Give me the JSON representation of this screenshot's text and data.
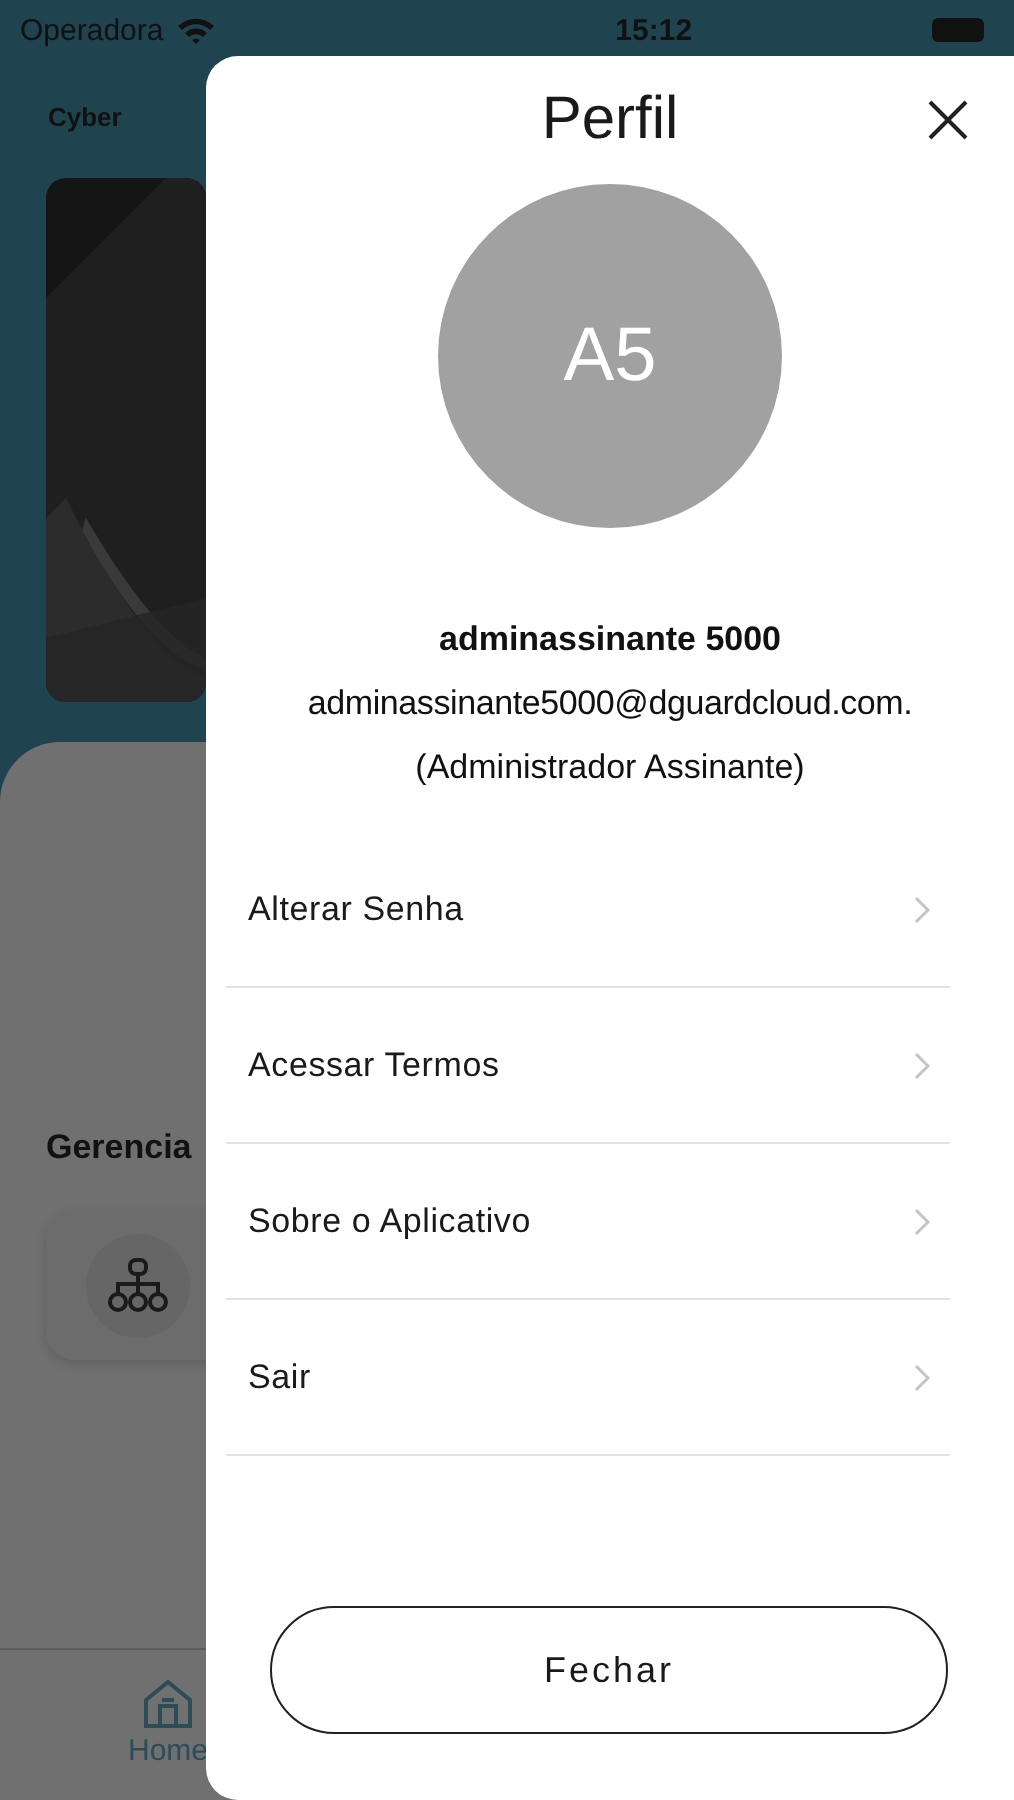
{
  "status_bar": {
    "carrier": "Operadora",
    "time": "15:12"
  },
  "background": {
    "header_title": "Cyber",
    "section_title": "Gerencia",
    "tab_bar": [
      {
        "label": "Home",
        "selected": true
      }
    ]
  },
  "profile": {
    "title": "Perfil",
    "avatar_initials": "A5",
    "name": "adminassinante 5000",
    "email": "adminassinante5000@dguardcloud.com.",
    "role": "(Administrador Assinante)",
    "menu": [
      {
        "label": "Alterar Senha"
      },
      {
        "label": "Acessar Termos"
      },
      {
        "label": "Sobre o Aplicativo"
      },
      {
        "label": "Sair"
      }
    ],
    "close_button": "Fechar"
  }
}
